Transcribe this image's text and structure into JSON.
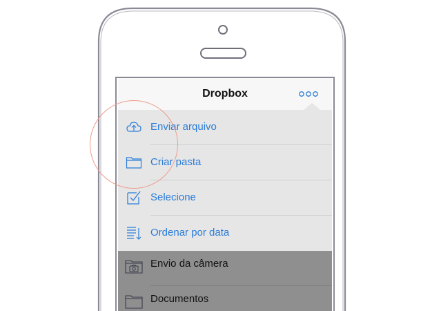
{
  "app": {
    "title": "Dropbox"
  },
  "menu": {
    "items": [
      {
        "label": "Enviar arquivo",
        "icon": "cloud-upload-icon"
      },
      {
        "label": "Criar pasta",
        "icon": "folder-icon"
      },
      {
        "label": "Selecione",
        "icon": "checkbox-icon"
      },
      {
        "label": "Ordenar por data",
        "icon": "sort-list-icon"
      }
    ]
  },
  "files": {
    "items": [
      {
        "label": "Envio da câmera",
        "icon": "camera-folder-icon"
      },
      {
        "label": "Documentos",
        "icon": "folder-icon"
      }
    ]
  },
  "colors": {
    "accent": "#2a7cd8",
    "highlight": "#ef9a8a"
  }
}
